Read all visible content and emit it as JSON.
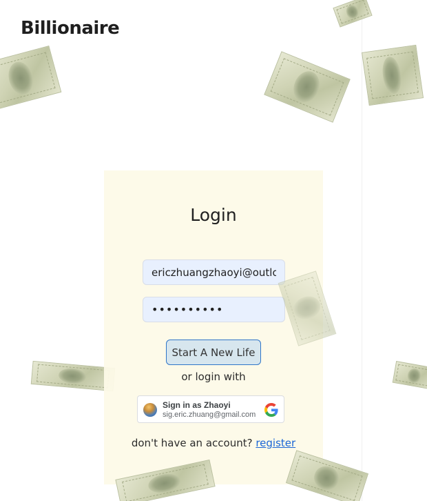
{
  "header": {
    "brand": "Billionaire"
  },
  "login": {
    "title": "Login",
    "email_value": "ericzhuangzhaoyi@outlook.com",
    "password_value": "••••••••••",
    "submit_label": "Start A New Life",
    "or_text": "or login with",
    "google": {
      "signin_text": "Sign in as Zhaoyi",
      "email": "sig.eric.zhuang@gmail.com"
    },
    "register_prompt": "don't have an account? ",
    "register_link": "register"
  },
  "colors": {
    "card_bg": "#fdfae8",
    "input_bg": "#e8f0fe",
    "button_border": "#2f75c8",
    "link": "#1a65d6"
  },
  "icons": {
    "google": "google-g-icon",
    "avatar": "user-avatar"
  }
}
